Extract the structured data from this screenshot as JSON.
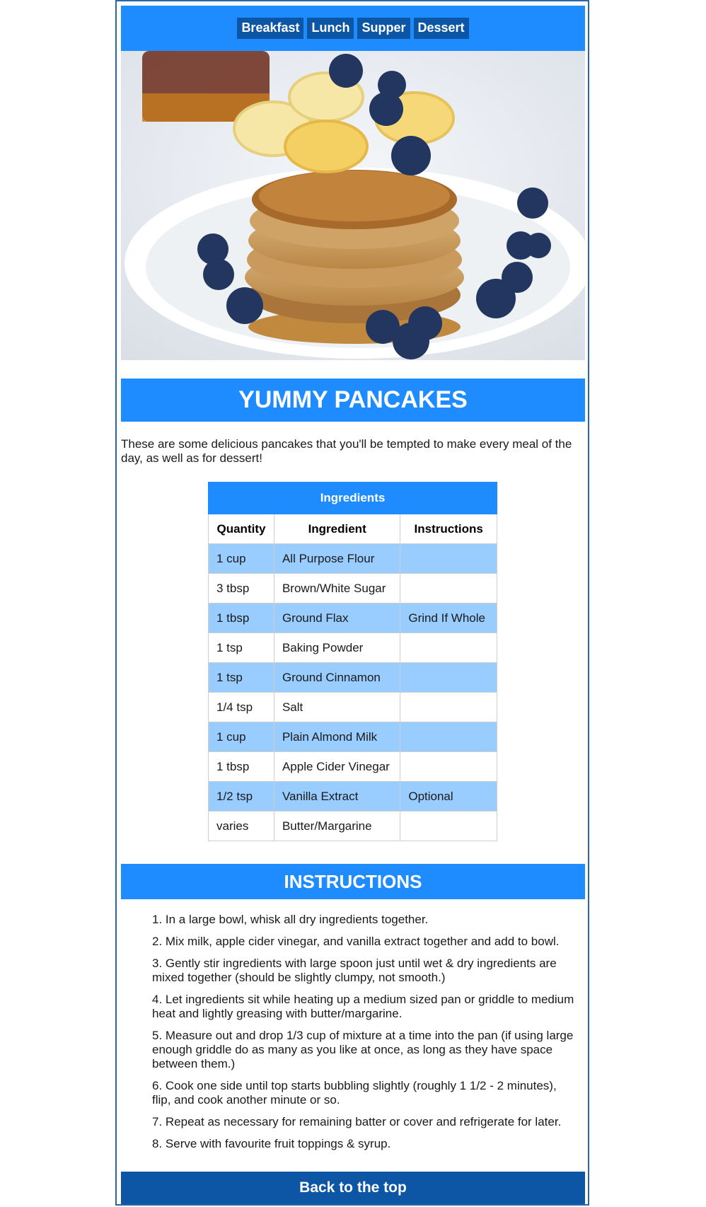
{
  "nav": {
    "items": [
      "Breakfast",
      "Lunch",
      "Supper",
      "Dessert"
    ]
  },
  "hero": {
    "alt": "Stack of pancakes with bananas, blueberries and syrup"
  },
  "title": "YUMMY PANCAKES",
  "intro": "These are some delicious pancakes that you'll be tempted to make every meal of the day, as well as for dessert!",
  "ingredients": {
    "caption": "Ingredients",
    "headers": [
      "Quantity",
      "Ingredient",
      "Instructions"
    ],
    "rows": [
      [
        "1 cup",
        "All Purpose Flour",
        ""
      ],
      [
        "3 tbsp",
        "Brown/White Sugar",
        ""
      ],
      [
        "1 tbsp",
        "Ground Flax",
        "Grind If Whole"
      ],
      [
        "1 tsp",
        "Baking Powder",
        ""
      ],
      [
        "1 tsp",
        "Ground Cinnamon",
        ""
      ],
      [
        "1/4 tsp",
        "Salt",
        ""
      ],
      [
        "1 cup",
        "Plain Almond Milk",
        ""
      ],
      [
        "1 tbsp",
        "Apple Cider Vinegar",
        ""
      ],
      [
        "1/2 tsp",
        "Vanilla Extract",
        "Optional"
      ],
      [
        "varies",
        "Butter/Margarine",
        ""
      ]
    ]
  },
  "instructions": {
    "heading": "INSTRUCTIONS",
    "steps": [
      "1. In a large bowl, whisk all dry ingredients together.",
      "2. Mix milk, apple cider vinegar, and vanilla extract together and add to bowl.",
      "3. Gently stir ingredients with large spoon just until wet & dry ingredients are mixed together (should be slightly clumpy, not smooth.)",
      "4. Let ingredients sit while heating up a medium sized pan or griddle to medium heat and lightly greasing with butter/margarine.",
      "5. Measure out and drop 1/3 cup of mixture at a time into the pan (if using large enough griddle do as many as you like at once, as long as they have space between them.)",
      "6. Cook one side until top starts bubbling slightly (roughly 1 1/2 - 2 minutes), flip, and cook another minute or so.",
      "7. Repeat as necessary for remaining batter or cover and refrigerate for later.",
      "8. Serve with favourite fruit toppings & syrup."
    ]
  },
  "back_to_top": "Back to the top",
  "colors": {
    "accent": "#1e8cff",
    "dark": "#0d56a6",
    "row_alt": "#99ccff",
    "border": "#2b67a8"
  }
}
